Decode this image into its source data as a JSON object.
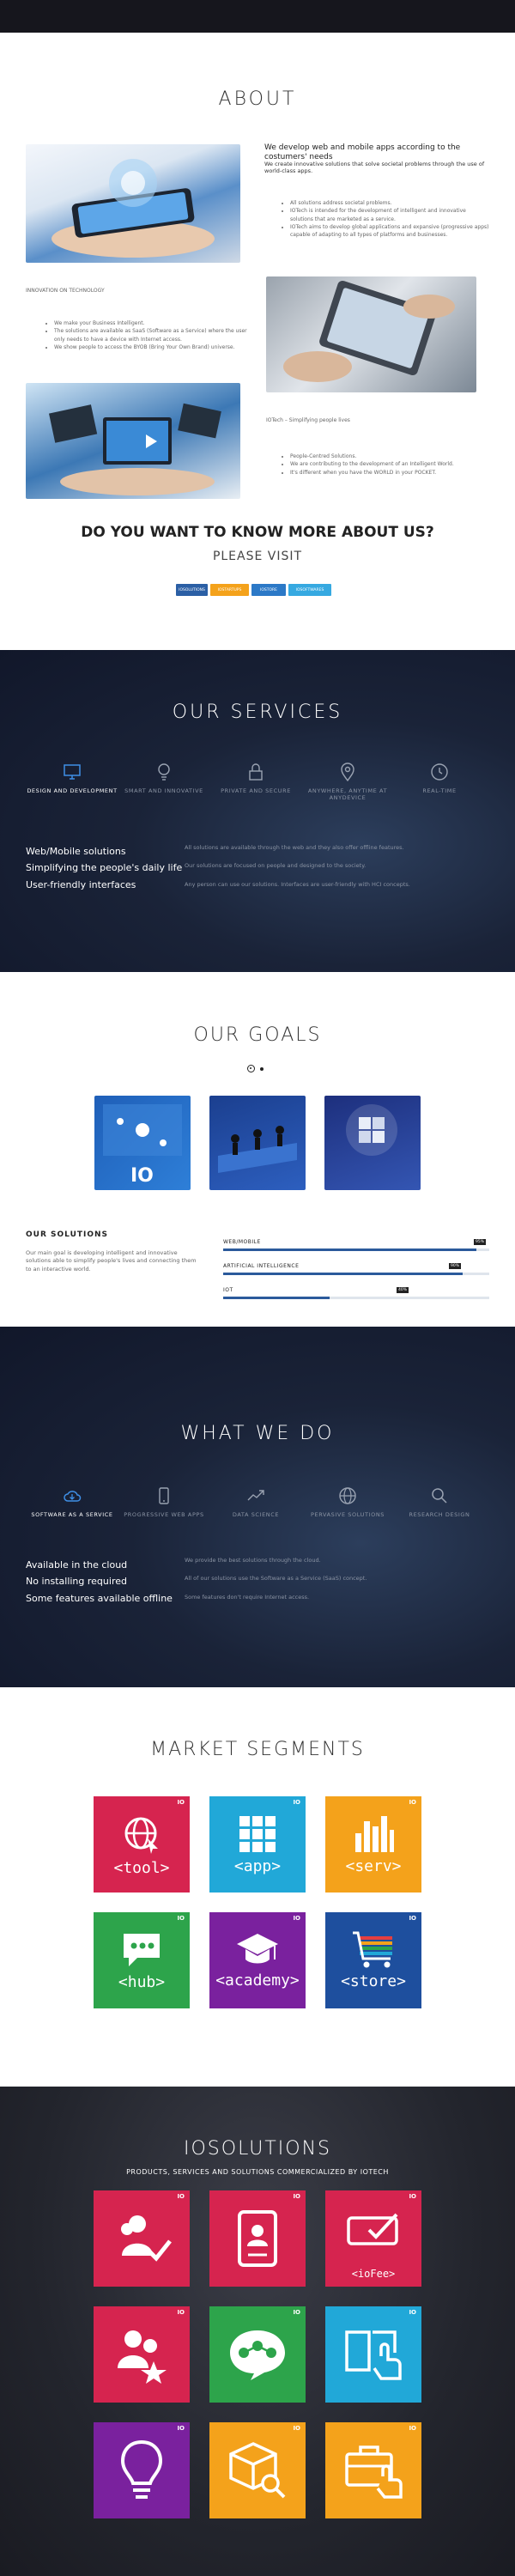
{
  "colors": {
    "dark_bg": "#16161d",
    "accent_blue": "#2b5a9b",
    "red": "#d6244f",
    "cyan": "#21a8d8",
    "orange": "#f4a21b",
    "green": "#2da44b",
    "purple": "#7a219e",
    "blue": "#1e4f9e"
  },
  "about": {
    "title": "ABOUT",
    "lead": "We develop web and mobile apps according to the costumers' needs",
    "sub": "We create innovative solutions that solve societal problems through the use of world-class apps.",
    "bullets1": [
      "All solutions address societal problems.",
      "IOTech is intended for the development of intelligent and innovative solutions that are marketed as a service.",
      "IOTech aims to develop global applications and expansive (progressive apps) capable of adapting to all types of platforms and businesses."
    ],
    "innovation_label": "INNOVATION ON TECHNOLOGY",
    "bullets2": [
      "We make your Business Intelligent.",
      "The solutions are available as SaaS (Software as a Service) where the user only needs to have a device with Internet access.",
      "We show people to access the BYOB (Bring Your Own Brand) universe."
    ],
    "isoft_label": "IOTech – Simplifying people lives",
    "bullets3": [
      "People-Centred Solutions.",
      "We are contributing to the development of an Intelligent World.",
      "It's different when you have the WORLD in your POCKET."
    ],
    "know_more": "DO YOU WANT TO KNOW MORE ABOUT US?",
    "visit": "PLEASE VISIT",
    "links": [
      {
        "label": "IOSOLUTIONS",
        "color": "#2b5fa5"
      },
      {
        "label": "IOSTARTUPS",
        "color": "#f4a21b"
      },
      {
        "label": "IOSTORE",
        "color": "#2c79c7"
      },
      {
        "label": "IOSOFTWARES",
        "color": "#36a9e1"
      }
    ]
  },
  "services": {
    "title": "OUR SERVICES",
    "features": [
      {
        "label": "DESIGN AND DEVELOPMENT",
        "icon": "monitor-icon"
      },
      {
        "label": "SMART AND INNOVATIVE",
        "icon": "lightbulb-icon"
      },
      {
        "label": "PRIVATE AND SECURE",
        "icon": "lock-icon"
      },
      {
        "label": "ANYWHERE, ANYTIME AT ANYDEVICE",
        "icon": "location-pin-icon"
      },
      {
        "label": "REAL-TIME",
        "icon": "clock-icon"
      }
    ],
    "big_lines": [
      "Web/Mobile solutions",
      "Simplifying the people's daily life",
      "User-friendly interfaces"
    ],
    "small_lines": [
      "All solutions are available through the web and they also offer offline features.",
      "Our solutions are focused on people and designed to the society.",
      "Any person can use our solutions. Interfaces are user-friendly with HCI concepts."
    ]
  },
  "goals": {
    "title": "OUR GOALS",
    "solutions_title": "OUR SOLUTIONS",
    "solutions_text": "Our main goal is developing intelligent and innovative solutions able to simplify people's lives and connecting them to an interactive world.",
    "bars": [
      {
        "label": "WEB/MOBILE",
        "value": 95,
        "value_label": "95%"
      },
      {
        "label": "ARTIFICIAL INTELLIGENCE",
        "value": 90,
        "value_label": "90%"
      },
      {
        "label": "IOT",
        "value": 40,
        "value_label": "40%"
      }
    ]
  },
  "whatwedo": {
    "title": "WHAT WE DO",
    "features": [
      {
        "label": "SOFTWARE AS A SERVICE",
        "icon": "cloud-icon"
      },
      {
        "label": "PROGRESSIVE WEB APPS",
        "icon": "mobile-icon"
      },
      {
        "label": "DATA SCIENCE",
        "icon": "chart-icon"
      },
      {
        "label": "PERVASIVE SOLUTIONS",
        "icon": "globe-icon"
      },
      {
        "label": "RESEARCH DESIGN",
        "icon": "search-icon"
      }
    ],
    "big_lines": [
      "Available in the cloud",
      "No installing required",
      "Some features available offline"
    ],
    "small_lines": [
      "We provide the best solutions through the cloud.",
      "All of our solutions use the Software as a Service (SaaS) concept.",
      "Some features don't require Internet access."
    ]
  },
  "market": {
    "title": "MARKET SEGMENTS",
    "io": "IO",
    "tiles": [
      {
        "name": "<tool>",
        "color": "#d6244f",
        "icon": "globe-icon"
      },
      {
        "name": "<app>",
        "color": "#21a8d8",
        "icon": "grid-icon"
      },
      {
        "name": "<serv>",
        "color": "#f4a21b",
        "icon": "bars-icon"
      },
      {
        "name": "<hub>",
        "color": "#2da44b",
        "icon": "chat-icon"
      },
      {
        "name": "<academy>",
        "color": "#7a219e",
        "icon": "graduation-cap-icon"
      },
      {
        "name": "<store>",
        "color": "#1e4f9e",
        "icon": "cart-icon"
      }
    ]
  },
  "iosolutions": {
    "title": "IOSOLUTIONS",
    "subtitle": "PRODUCTS, SERVICES AND SOLUTIONS COMMERCIALIZED BY IOTECH",
    "io": "IO",
    "tiles": [
      {
        "color": "#d6244f",
        "icon": "users-check-icon",
        "name": ""
      },
      {
        "color": "#d6244f",
        "icon": "id-card-icon",
        "name": ""
      },
      {
        "color": "#d6244f",
        "icon": "ticket-check-icon",
        "name": "<ioFee>"
      },
      {
        "color": "#d6244f",
        "icon": "users-star-icon",
        "name": ""
      },
      {
        "color": "#2da44b",
        "icon": "chat-bubble-icon",
        "name": ""
      },
      {
        "color": "#21a8d8",
        "icon": "book-touch-icon",
        "name": ""
      },
      {
        "color": "#7a219e",
        "icon": "lightbulb-icon",
        "name": ""
      },
      {
        "color": "#f4a21b",
        "icon": "box-search-icon",
        "name": ""
      },
      {
        "color": "#f4a21b",
        "icon": "briefcase-touch-icon",
        "name": ""
      }
    ]
  }
}
